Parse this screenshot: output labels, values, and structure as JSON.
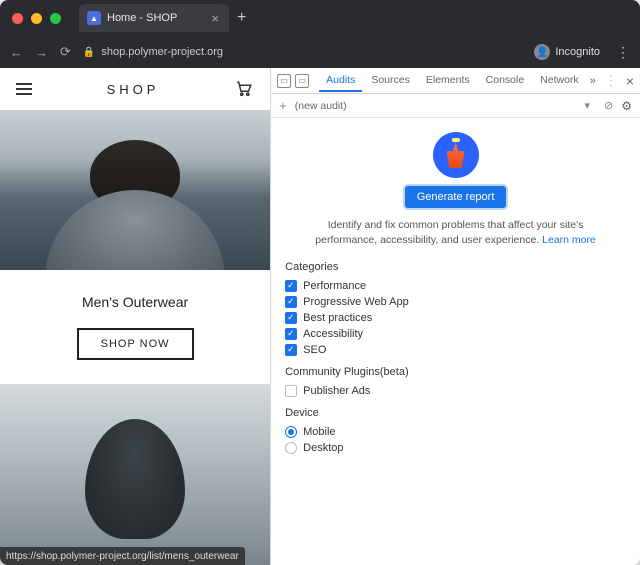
{
  "browser": {
    "tab_title": "Home - SHOP",
    "url": "shop.polymer-project.org",
    "incognito_label": "Incognito",
    "status_url": "https://shop.polymer-project.org/list/mens_outerwear"
  },
  "page": {
    "logo": "SHOP",
    "section_title": "Men's Outerwear",
    "shop_now": "SHOP NOW"
  },
  "devtools": {
    "tabs": [
      "Audits",
      "Sources",
      "Elements",
      "Console",
      "Network"
    ],
    "active_tab": "Audits",
    "subbar_label": "(new audit)",
    "generate_label": "Generate report",
    "description_a": "Identify and fix common problems that affect your site's",
    "description_b": "performance, accessibility, and user experience.",
    "learn_more": "Learn more",
    "categories_title": "Categories",
    "categories": [
      {
        "label": "Performance",
        "checked": true
      },
      {
        "label": "Progressive Web App",
        "checked": true
      },
      {
        "label": "Best practices",
        "checked": true
      },
      {
        "label": "Accessibility",
        "checked": true
      },
      {
        "label": "SEO",
        "checked": true
      }
    ],
    "plugins_title": "Community Plugins(beta)",
    "plugins": [
      {
        "label": "Publisher Ads",
        "checked": false
      }
    ],
    "device_title": "Device",
    "devices": [
      {
        "label": "Mobile",
        "selected": true
      },
      {
        "label": "Desktop",
        "selected": false
      }
    ]
  }
}
